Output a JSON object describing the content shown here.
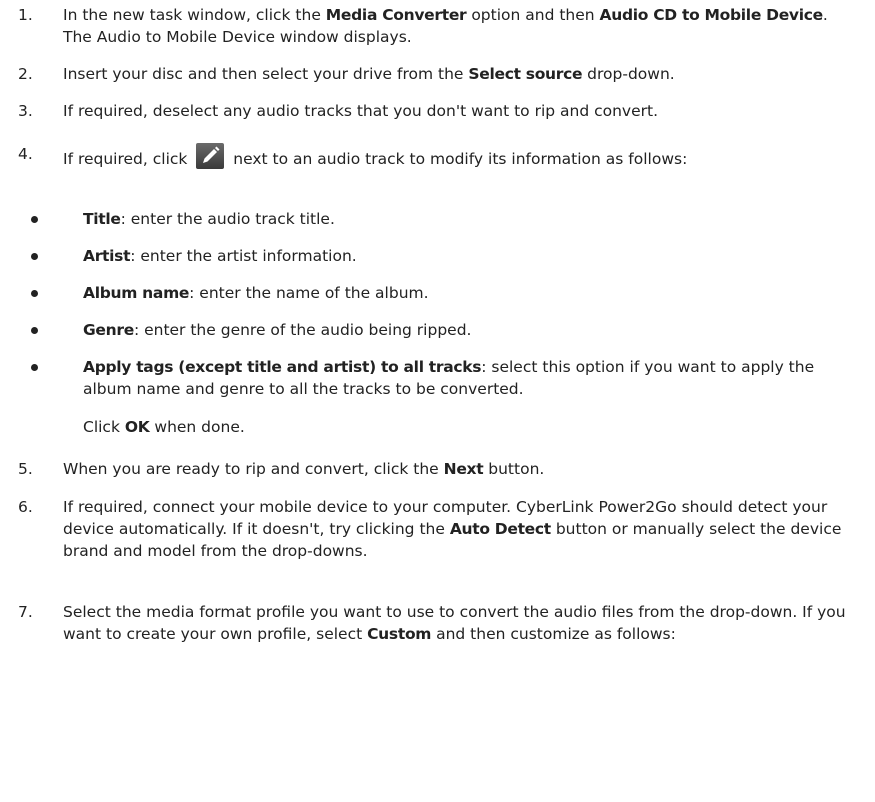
{
  "steps": [
    {
      "num": "1.",
      "parts": [
        "In the new task window, click the ",
        "Media Converter",
        " option and then ",
        "Audio CD to Mobile Device",
        ". The Audio to Mobile Device window displays."
      ]
    },
    {
      "num": "2.",
      "parts": [
        "Insert your disc and then select your drive from the ",
        "Select source",
        " drop-down."
      ]
    },
    {
      "num": "3.",
      "parts": [
        "If required, deselect any audio tracks that you don't want to rip and convert."
      ]
    },
    {
      "num": "4.",
      "parts": [
        "If required, click ",
        " next to an audio track to modify its information as follows:"
      ]
    },
    {
      "num": "5.",
      "parts": [
        "When you are ready to rip and convert, click the ",
        "Next",
        " button."
      ]
    },
    {
      "num": "6.",
      "parts": [
        "If required, connect your mobile device to your computer. CyberLink Power2Go should detect your device automatically. If it doesn't, try clicking the ",
        "Auto Detect",
        " button or manually select the device brand and model from the drop-downs."
      ]
    },
    {
      "num": "7.",
      "parts": [
        "Select the media format profile you want to use to convert the audio files from the drop-down. If you want to create your own profile, select ",
        "Custom",
        " and then customize as follows:"
      ]
    }
  ],
  "bullets": [
    {
      "term": "Title",
      "desc": ": enter the audio track title."
    },
    {
      "term": "Artist",
      "desc": ": enter the artist information."
    },
    {
      "term": "Album name",
      "desc": ": enter the name of the album."
    },
    {
      "term": "Genre",
      "desc": ": enter the genre of the audio being ripped."
    },
    {
      "term": "Apply tags (except title and artist) to all tracks",
      "desc": ": select this option if you want to apply the album name and genre to all the tracks to be converted."
    }
  ],
  "note": {
    "before": "Click ",
    "term": "OK",
    "after": " when done."
  },
  "icons": {
    "edit": "pencil-edit-icon"
  }
}
